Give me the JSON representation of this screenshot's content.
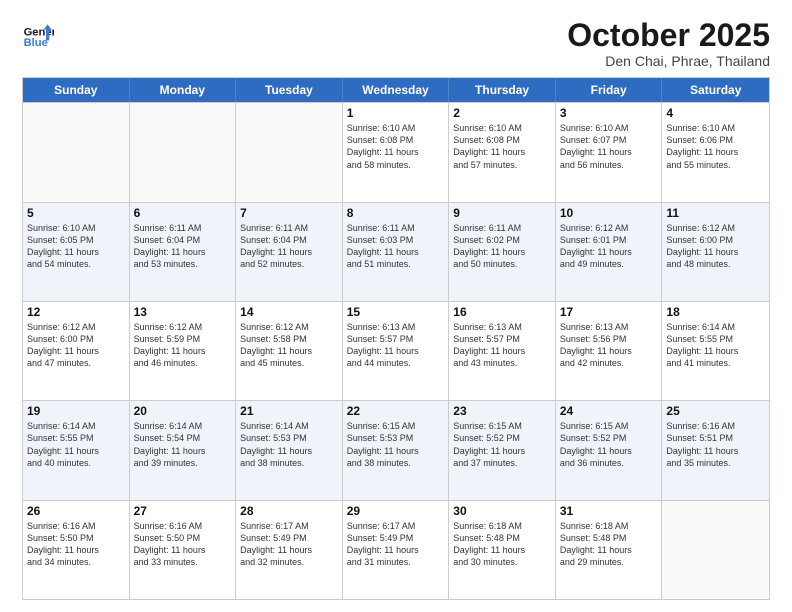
{
  "header": {
    "logo_general": "General",
    "logo_blue": "Blue",
    "month_title": "October 2025",
    "location": "Den Chai, Phrae, Thailand"
  },
  "weekdays": [
    "Sunday",
    "Monday",
    "Tuesday",
    "Wednesday",
    "Thursday",
    "Friday",
    "Saturday"
  ],
  "rows": [
    {
      "shade": "row-white",
      "cells": [
        {
          "day": "",
          "lines": []
        },
        {
          "day": "",
          "lines": []
        },
        {
          "day": "",
          "lines": []
        },
        {
          "day": "1",
          "lines": [
            "Sunrise: 6:10 AM",
            "Sunset: 6:08 PM",
            "Daylight: 11 hours",
            "and 58 minutes."
          ]
        },
        {
          "day": "2",
          "lines": [
            "Sunrise: 6:10 AM",
            "Sunset: 6:08 PM",
            "Daylight: 11 hours",
            "and 57 minutes."
          ]
        },
        {
          "day": "3",
          "lines": [
            "Sunrise: 6:10 AM",
            "Sunset: 6:07 PM",
            "Daylight: 11 hours",
            "and 56 minutes."
          ]
        },
        {
          "day": "4",
          "lines": [
            "Sunrise: 6:10 AM",
            "Sunset: 6:06 PM",
            "Daylight: 11 hours",
            "and 55 minutes."
          ]
        }
      ]
    },
    {
      "shade": "row-shade",
      "cells": [
        {
          "day": "5",
          "lines": [
            "Sunrise: 6:10 AM",
            "Sunset: 6:05 PM",
            "Daylight: 11 hours",
            "and 54 minutes."
          ]
        },
        {
          "day": "6",
          "lines": [
            "Sunrise: 6:11 AM",
            "Sunset: 6:04 PM",
            "Daylight: 11 hours",
            "and 53 minutes."
          ]
        },
        {
          "day": "7",
          "lines": [
            "Sunrise: 6:11 AM",
            "Sunset: 6:04 PM",
            "Daylight: 11 hours",
            "and 52 minutes."
          ]
        },
        {
          "day": "8",
          "lines": [
            "Sunrise: 6:11 AM",
            "Sunset: 6:03 PM",
            "Daylight: 11 hours",
            "and 51 minutes."
          ]
        },
        {
          "day": "9",
          "lines": [
            "Sunrise: 6:11 AM",
            "Sunset: 6:02 PM",
            "Daylight: 11 hours",
            "and 50 minutes."
          ]
        },
        {
          "day": "10",
          "lines": [
            "Sunrise: 6:12 AM",
            "Sunset: 6:01 PM",
            "Daylight: 11 hours",
            "and 49 minutes."
          ]
        },
        {
          "day": "11",
          "lines": [
            "Sunrise: 6:12 AM",
            "Sunset: 6:00 PM",
            "Daylight: 11 hours",
            "and 48 minutes."
          ]
        }
      ]
    },
    {
      "shade": "row-white",
      "cells": [
        {
          "day": "12",
          "lines": [
            "Sunrise: 6:12 AM",
            "Sunset: 6:00 PM",
            "Daylight: 11 hours",
            "and 47 minutes."
          ]
        },
        {
          "day": "13",
          "lines": [
            "Sunrise: 6:12 AM",
            "Sunset: 5:59 PM",
            "Daylight: 11 hours",
            "and 46 minutes."
          ]
        },
        {
          "day": "14",
          "lines": [
            "Sunrise: 6:12 AM",
            "Sunset: 5:58 PM",
            "Daylight: 11 hours",
            "and 45 minutes."
          ]
        },
        {
          "day": "15",
          "lines": [
            "Sunrise: 6:13 AM",
            "Sunset: 5:57 PM",
            "Daylight: 11 hours",
            "and 44 minutes."
          ]
        },
        {
          "day": "16",
          "lines": [
            "Sunrise: 6:13 AM",
            "Sunset: 5:57 PM",
            "Daylight: 11 hours",
            "and 43 minutes."
          ]
        },
        {
          "day": "17",
          "lines": [
            "Sunrise: 6:13 AM",
            "Sunset: 5:56 PM",
            "Daylight: 11 hours",
            "and 42 minutes."
          ]
        },
        {
          "day": "18",
          "lines": [
            "Sunrise: 6:14 AM",
            "Sunset: 5:55 PM",
            "Daylight: 11 hours",
            "and 41 minutes."
          ]
        }
      ]
    },
    {
      "shade": "row-shade",
      "cells": [
        {
          "day": "19",
          "lines": [
            "Sunrise: 6:14 AM",
            "Sunset: 5:55 PM",
            "Daylight: 11 hours",
            "and 40 minutes."
          ]
        },
        {
          "day": "20",
          "lines": [
            "Sunrise: 6:14 AM",
            "Sunset: 5:54 PM",
            "Daylight: 11 hours",
            "and 39 minutes."
          ]
        },
        {
          "day": "21",
          "lines": [
            "Sunrise: 6:14 AM",
            "Sunset: 5:53 PM",
            "Daylight: 11 hours",
            "and 38 minutes."
          ]
        },
        {
          "day": "22",
          "lines": [
            "Sunrise: 6:15 AM",
            "Sunset: 5:53 PM",
            "Daylight: 11 hours",
            "and 38 minutes."
          ]
        },
        {
          "day": "23",
          "lines": [
            "Sunrise: 6:15 AM",
            "Sunset: 5:52 PM",
            "Daylight: 11 hours",
            "and 37 minutes."
          ]
        },
        {
          "day": "24",
          "lines": [
            "Sunrise: 6:15 AM",
            "Sunset: 5:52 PM",
            "Daylight: 11 hours",
            "and 36 minutes."
          ]
        },
        {
          "day": "25",
          "lines": [
            "Sunrise: 6:16 AM",
            "Sunset: 5:51 PM",
            "Daylight: 11 hours",
            "and 35 minutes."
          ]
        }
      ]
    },
    {
      "shade": "row-white",
      "cells": [
        {
          "day": "26",
          "lines": [
            "Sunrise: 6:16 AM",
            "Sunset: 5:50 PM",
            "Daylight: 11 hours",
            "and 34 minutes."
          ]
        },
        {
          "day": "27",
          "lines": [
            "Sunrise: 6:16 AM",
            "Sunset: 5:50 PM",
            "Daylight: 11 hours",
            "and 33 minutes."
          ]
        },
        {
          "day": "28",
          "lines": [
            "Sunrise: 6:17 AM",
            "Sunset: 5:49 PM",
            "Daylight: 11 hours",
            "and 32 minutes."
          ]
        },
        {
          "day": "29",
          "lines": [
            "Sunrise: 6:17 AM",
            "Sunset: 5:49 PM",
            "Daylight: 11 hours",
            "and 31 minutes."
          ]
        },
        {
          "day": "30",
          "lines": [
            "Sunrise: 6:18 AM",
            "Sunset: 5:48 PM",
            "Daylight: 11 hours",
            "and 30 minutes."
          ]
        },
        {
          "day": "31",
          "lines": [
            "Sunrise: 6:18 AM",
            "Sunset: 5:48 PM",
            "Daylight: 11 hours",
            "and 29 minutes."
          ]
        },
        {
          "day": "",
          "lines": []
        }
      ]
    }
  ]
}
